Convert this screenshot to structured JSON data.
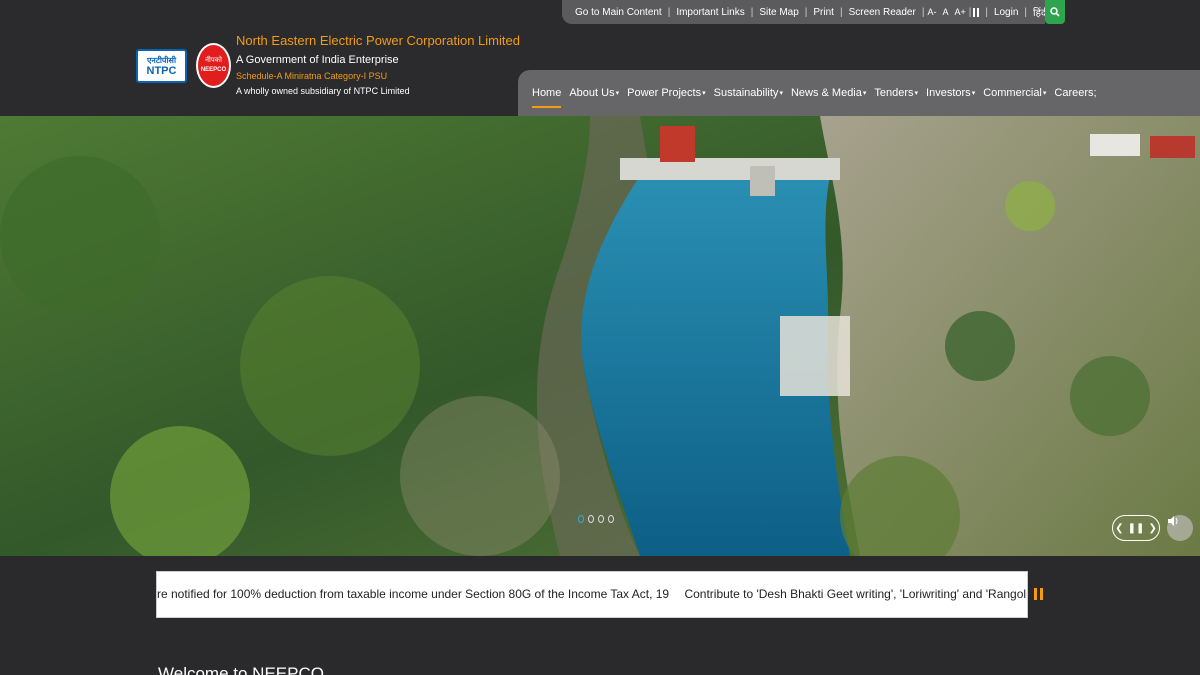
{
  "topbar": {
    "links": [
      "Go to Main Content",
      "Important Links",
      "Site Map",
      "Print",
      "Screen Reader"
    ],
    "font_sizes": [
      "A-",
      "A",
      "A+"
    ],
    "login": "Login",
    "hindi": "हिंदी"
  },
  "org": {
    "ntpc_hindi": "एनटीपीसी",
    "ntpc": "NTPC",
    "neepco_hindi": "नीपको",
    "neepco": "NEEPCO",
    "name": "North Eastern Electric Power Corporation Limited",
    "sub1": "A Government of India Enterprise",
    "sub2": "Schedule-A Miniratna Category-I PSU",
    "sub3": "A wholly owned subsidiary of NTPC Limited"
  },
  "nav": {
    "items": [
      "Home",
      "About Us",
      "Power Projects",
      "Sustainability",
      "News & Media",
      "Tenders",
      "Investors",
      "Commercial",
      "Careers;"
    ]
  },
  "ticker": {
    "items": [
      "re notified for 100% deduction from taxable income under Section 80G of the Income Tax Act, 19",
      "Contribute to 'Desh Bhakti Geet writing', 'Loriwriting' and 'Rangoli makin"
    ]
  },
  "welcome": "Welcome to NEEPCO",
  "colors": {
    "accent": "#f39c12",
    "search": "#2ea44f",
    "nav_bg": "#666669"
  }
}
